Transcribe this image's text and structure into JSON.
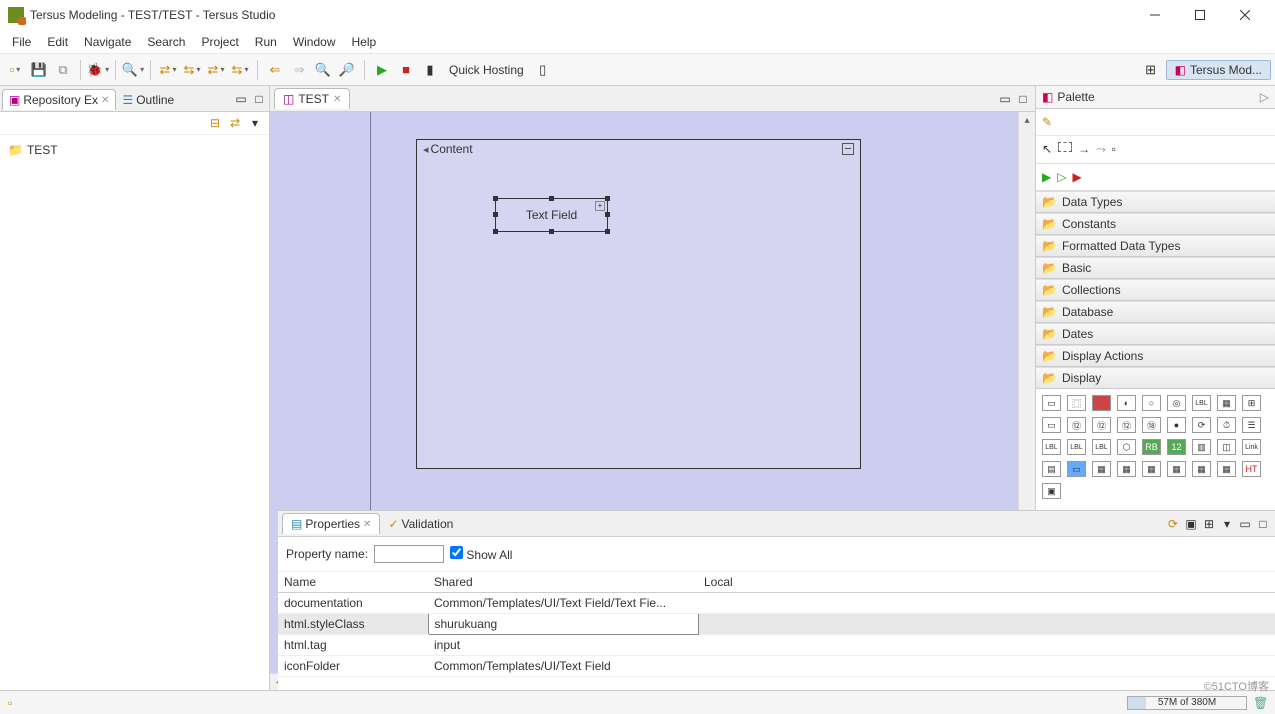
{
  "title": "Tersus Modeling - TEST/TEST - Tersus Studio",
  "menus": [
    "File",
    "Edit",
    "Navigate",
    "Search",
    "Project",
    "Run",
    "Window",
    "Help"
  ],
  "toolbar": {
    "quick_hosting": "Quick Hosting"
  },
  "perspective": {
    "label": "Tersus Mod..."
  },
  "left": {
    "tabs": {
      "repo": "Repository Ex",
      "outline": "Outline"
    },
    "tree": {
      "root": "TEST"
    }
  },
  "editor": {
    "tab": "TEST",
    "content_label": "Content",
    "textfield_label": "Text Field"
  },
  "palette": {
    "title": "Palette",
    "categories": [
      "Data Types",
      "Constants",
      "Formatted Data Types",
      "Basic",
      "Collections",
      "Database",
      "Dates",
      "Display Actions",
      "Display"
    ],
    "icon_names": [
      "panel",
      "row",
      "bar",
      "toggle",
      "ellipse",
      "ring",
      "label",
      "table",
      "grid",
      "box",
      "segment1",
      "segment2",
      "segment12",
      "segment14",
      "segment18",
      "circle",
      "spiral",
      "timer",
      "list2",
      "list4",
      "list6",
      "hex",
      "tiles-a",
      "tiles-h",
      "panel12",
      "insert",
      "link",
      "doc",
      "win1",
      "win2",
      "win3",
      "win4",
      "tableA",
      "tableB",
      "tableC",
      "tableD",
      "barsH",
      "barsT",
      "note"
    ]
  },
  "bottom": {
    "tabs": {
      "properties": "Properties",
      "validation": "Validation"
    },
    "filter_label": "Property name:",
    "show_all": "Show All",
    "cols": {
      "name": "Name",
      "shared": "Shared",
      "local": "Local"
    },
    "rows": [
      {
        "name": "documentation",
        "shared": "Common/Templates/UI/Text Field/Text Fie...",
        "local": ""
      },
      {
        "name": "html.styleClass",
        "shared": "shurukuang",
        "local": ""
      },
      {
        "name": "html.tag",
        "shared": "input",
        "local": ""
      },
      {
        "name": "iconFolder",
        "shared": "Common/Templates/UI/Text Field",
        "local": ""
      }
    ]
  },
  "status": {
    "memory": "57M of 380M"
  },
  "watermark": "©51CTO博客"
}
